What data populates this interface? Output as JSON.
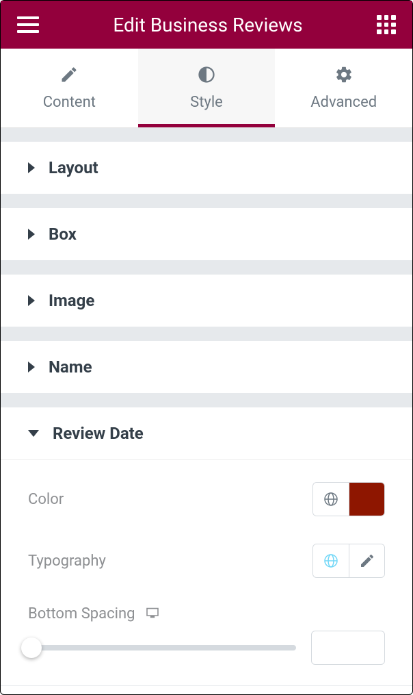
{
  "header": {
    "title": "Edit Business Reviews"
  },
  "tabs": {
    "content": "Content",
    "style": "Style",
    "advanced": "Advanced",
    "active": "style"
  },
  "sections": {
    "layout": {
      "label": "Layout",
      "expanded": false
    },
    "box": {
      "label": "Box",
      "expanded": false
    },
    "image": {
      "label": "Image",
      "expanded": false
    },
    "name": {
      "label": "Name",
      "expanded": false
    },
    "review_date": {
      "label": "Review Date",
      "expanded": true,
      "controls": {
        "color": {
          "label": "Color",
          "value": "#8e1600"
        },
        "typography": {
          "label": "Typography",
          "global_active": true
        },
        "bottom_spacing": {
          "label": "Bottom Spacing",
          "value": ""
        }
      }
    }
  }
}
